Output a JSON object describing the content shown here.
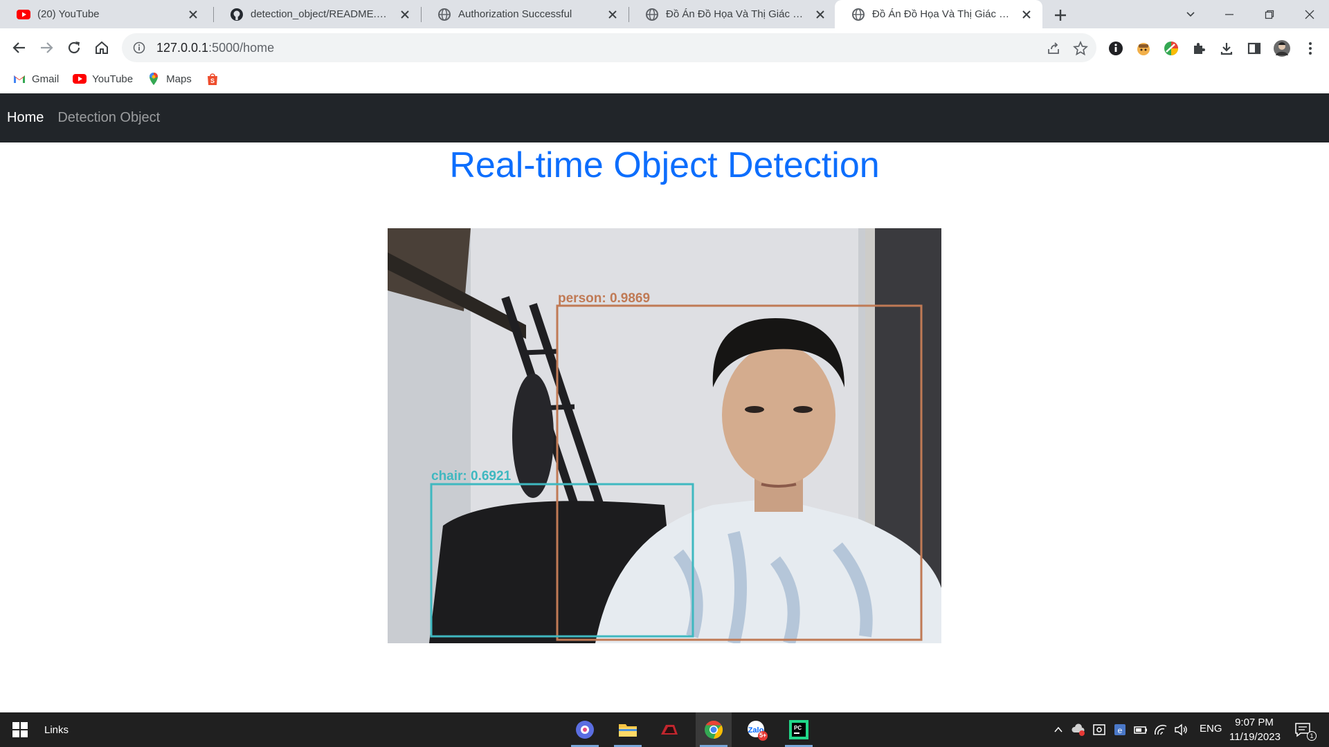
{
  "browser": {
    "tabs": [
      {
        "title": "(20) YouTube",
        "icon": "youtube-icon",
        "active": false
      },
      {
        "title": "detection_object/README.md at",
        "icon": "github-icon",
        "active": false
      },
      {
        "title": "Authorization Successful",
        "icon": "globe-icon",
        "active": false
      },
      {
        "title": "Đồ Án Đồ Họa Và Thị Giác Máy Tính",
        "icon": "globe-icon",
        "active": false
      },
      {
        "title": "Đồ Án Đồ Họa Và Thị Giác Máy Tính",
        "icon": "globe-icon",
        "active": true
      }
    ],
    "address": {
      "host": "127.0.0.1",
      "path": ":5000/home"
    },
    "bookmarks": [
      {
        "label": "Gmail",
        "icon": "gmail-icon"
      },
      {
        "label": "YouTube",
        "icon": "youtube-icon"
      },
      {
        "label": "Maps",
        "icon": "maps-icon"
      },
      {
        "label": "",
        "icon": "shopee-icon"
      }
    ]
  },
  "page": {
    "nav": [
      {
        "label": "Home",
        "active": true
      },
      {
        "label": "Detection Object",
        "active": false
      }
    ],
    "heading": "Real-time Object Detection",
    "detections": [
      {
        "label": "person: 0.9869",
        "color": "#c07a55"
      },
      {
        "label": "chair: 0.6921",
        "color": "#3fb8c0"
      }
    ]
  },
  "taskbar": {
    "links_label": "Links",
    "language": "ENG",
    "time": "9:07 PM",
    "date": "11/19/2023",
    "notification_count": "1",
    "zalo_badge": "5+"
  },
  "colors": {
    "accent": "#0d6efd",
    "navbar_bg": "#212529",
    "tabstrip_bg": "#dee1e6",
    "taskbar_bg": "#202020"
  }
}
